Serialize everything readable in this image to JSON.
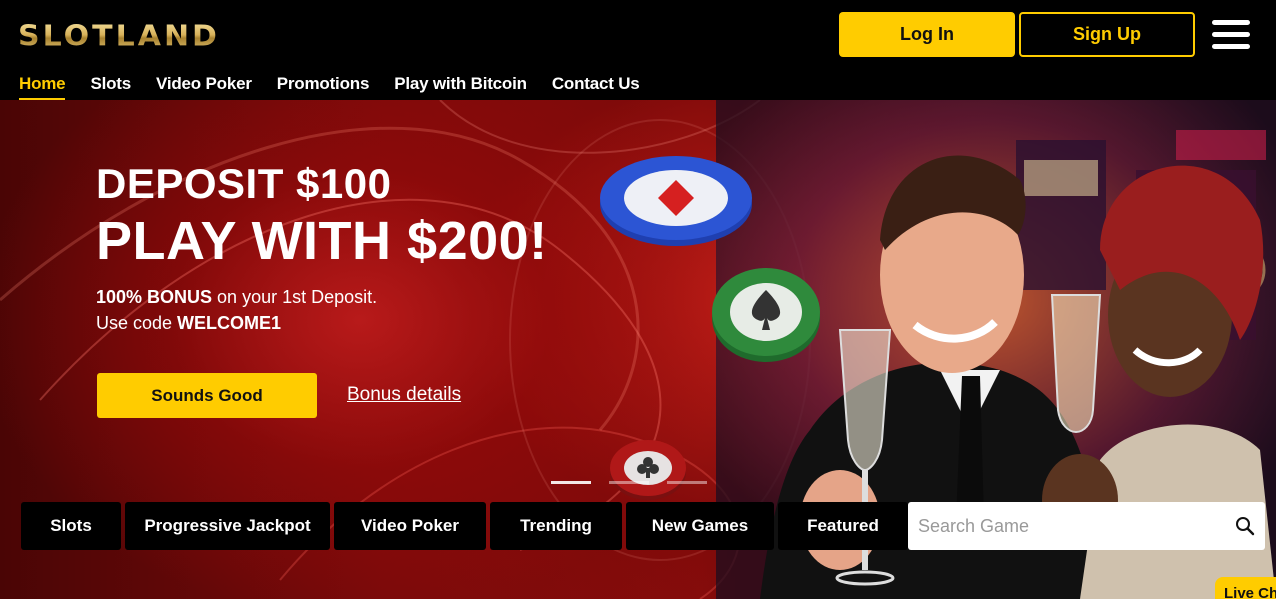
{
  "brand": {
    "logo_text": "SLOTLAND",
    "accent": "#ffcc00"
  },
  "header": {
    "login_label": "Log In",
    "signup_label": "Sign Up",
    "menu_icon": "hamburger-menu-icon"
  },
  "nav": {
    "items": [
      {
        "label": "Home",
        "active": true
      },
      {
        "label": "Slots"
      },
      {
        "label": "Video Poker"
      },
      {
        "label": "Promotions"
      },
      {
        "label": "Play with Bitcoin"
      },
      {
        "label": "Contact Us"
      }
    ]
  },
  "hero": {
    "title_line1": "DEPOSIT $100",
    "title_line2": "PLAY WITH $200!",
    "bonus_strong": "100% BONUS",
    "bonus_rest": " on your 1st Deposit.",
    "code_prefix": "Use code ",
    "code": "WELCOME1",
    "cta_label": "Sounds Good",
    "details_link": "Bonus details",
    "slide_count": 3,
    "active_slide": 1
  },
  "categories": {
    "items": [
      {
        "label": "Slots"
      },
      {
        "label": "Progressive Jackpot"
      },
      {
        "label": "Video Poker"
      },
      {
        "label": "Trending"
      },
      {
        "label": "New Games"
      },
      {
        "label": "Featured"
      }
    ],
    "search_placeholder": "Search Game",
    "search_icon": "search-icon"
  },
  "live_chat": {
    "label": "Live Ch"
  }
}
